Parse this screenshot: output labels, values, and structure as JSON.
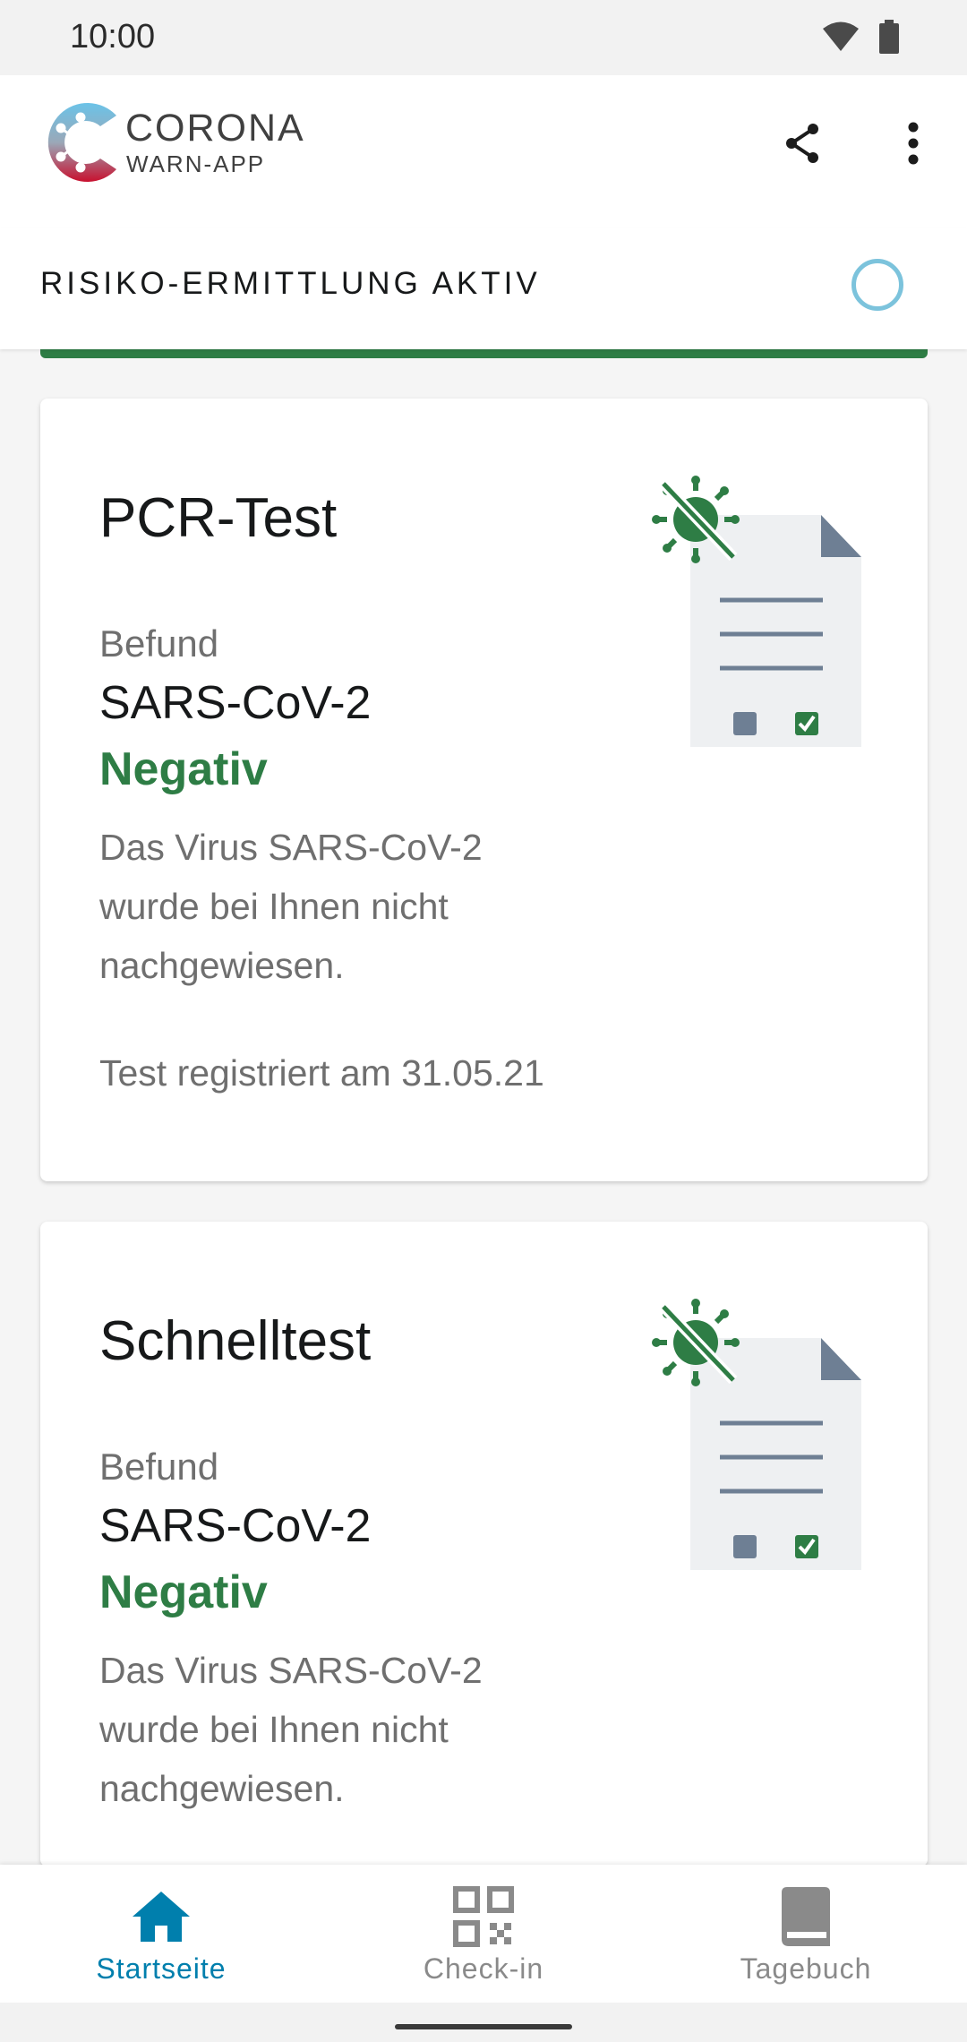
{
  "status_bar": {
    "time": "10:00",
    "icons": [
      "wifi-icon",
      "battery-icon"
    ]
  },
  "app_bar": {
    "brand_title": "CORONA",
    "brand_subtitle": "WARN-APP",
    "actions": [
      "share-icon",
      "more-vert-icon"
    ]
  },
  "risk": {
    "label": "RISIKO-ERMITTLUNG AKTIV",
    "status_color": "#2e7d45",
    "spinner_color": "#7cc3dc"
  },
  "cards": [
    {
      "title": "PCR-Test",
      "befund_label": "Befund",
      "virus": "SARS-CoV-2",
      "result": "Negativ",
      "description": "Das Virus SARS-CoV-2 wurde bei Ihnen nicht nachgewiesen.",
      "registered": "Test registriert am 31.05.21"
    },
    {
      "title": "Schnelltest",
      "befund_label": "Befund",
      "virus": "SARS-CoV-2",
      "result": "Negativ",
      "description": "Das Virus SARS-CoV-2 wurde bei Ihnen nicht nachgewiesen."
    }
  ],
  "bottom_nav": {
    "items": [
      {
        "label": "Startseite",
        "icon": "home-icon",
        "active": true
      },
      {
        "label": "Check-in",
        "icon": "qr-code-icon",
        "active": false
      },
      {
        "label": "Tagebuch",
        "icon": "book-icon",
        "active": false
      }
    ],
    "active_color": "#007fad",
    "inactive_color": "#8a8a8a"
  },
  "colors": {
    "accent_green": "#2e7d45",
    "accent_blue": "#007fad"
  }
}
